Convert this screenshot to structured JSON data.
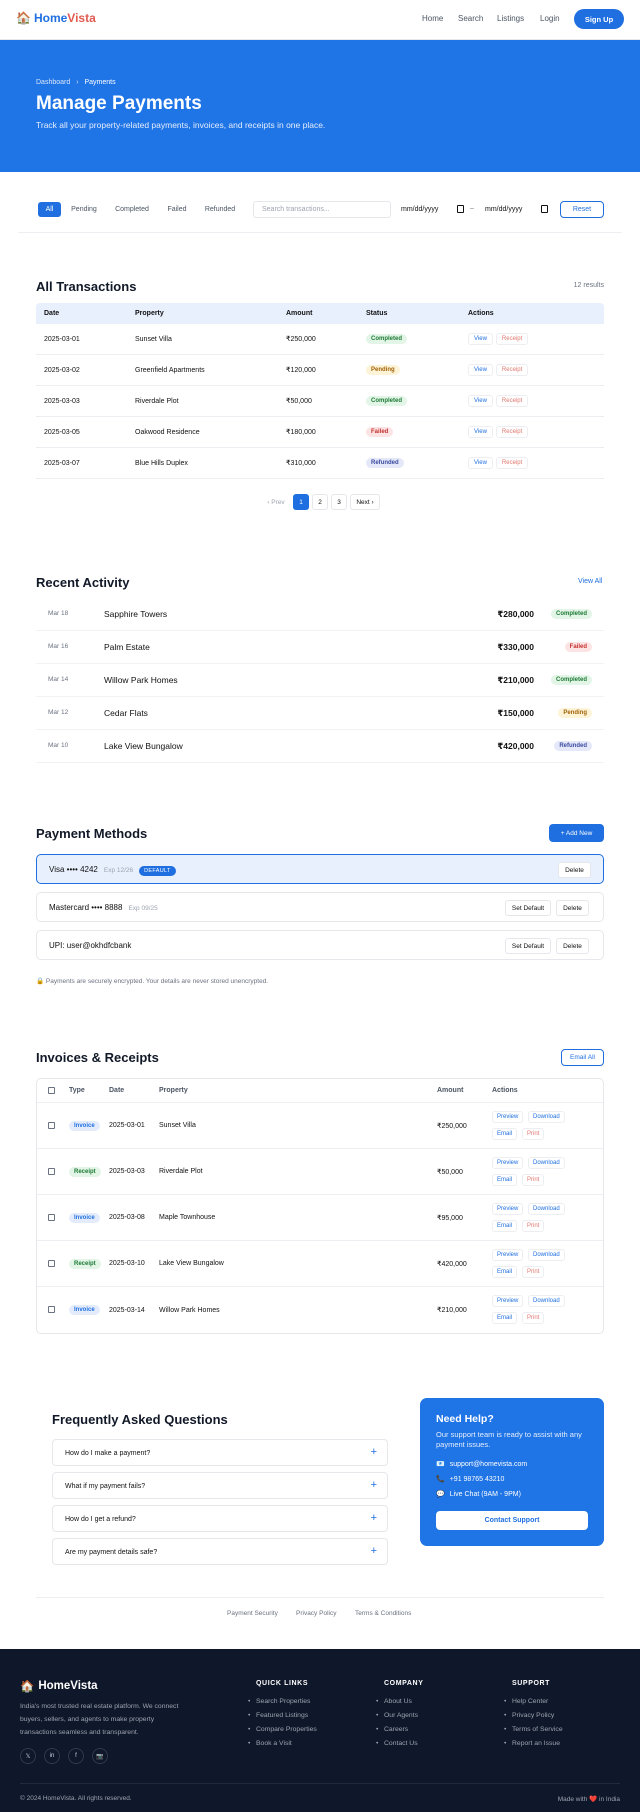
{
  "nav": {
    "brand_home": "Home",
    "brand_vista": "Vista",
    "links": [
      "Home",
      "Search",
      "Listings",
      "Login"
    ],
    "signup": "Sign Up"
  },
  "hero": {
    "crumb_root": "Dashboard",
    "crumb_sep": "›",
    "crumb_current": "Payments",
    "title": "Manage Payments",
    "subtitle": "Track all your property-related payments, invoices, and receipts in one place."
  },
  "filters": {
    "tabs": [
      "All",
      "Pending",
      "Completed",
      "Failed",
      "Refunded"
    ],
    "search_placeholder": "Search transactions...",
    "date_from": "mm/dd/yyyy",
    "date_sep": "–",
    "date_to": "mm/dd/yyyy",
    "reset": "Reset"
  },
  "transactions": {
    "title": "All Transactions",
    "count": "12 results",
    "headers": [
      "Date",
      "Property",
      "Amount",
      "Status",
      "Actions"
    ],
    "rows": [
      {
        "date": "2025-03-01",
        "property": "Sunset Villa",
        "amount": "₹250,000",
        "status": "Completed",
        "view": "View",
        "receipt": "Receipt"
      },
      {
        "date": "2025-03-02",
        "property": "Greenfield Apartments",
        "amount": "₹120,000",
        "status": "Pending",
        "view": "View",
        "receipt": "Receipt"
      },
      {
        "date": "2025-03-03",
        "property": "Riverdale Plot",
        "amount": "₹50,000",
        "status": "Completed",
        "view": "View",
        "receipt": "Receipt"
      },
      {
        "date": "2025-03-05",
        "property": "Oakwood Residence",
        "amount": "₹180,000",
        "status": "Failed",
        "view": "View",
        "receipt": "Receipt"
      },
      {
        "date": "2025-03-07",
        "property": "Blue Hills Duplex",
        "amount": "₹310,000",
        "status": "Refunded",
        "view": "View",
        "receipt": "Receipt"
      }
    ],
    "pager": {
      "prev": "‹ Prev",
      "pages": [
        "1",
        "2",
        "3"
      ],
      "next": "Next ›"
    }
  },
  "activity": {
    "title": "Recent Activity",
    "view_all": "View All",
    "items": [
      {
        "date": "Mar 18",
        "name": "Sapphire Towers",
        "amount": "₹280,000",
        "status": "Completed"
      },
      {
        "date": "Mar 16",
        "name": "Palm Estate",
        "amount": "₹330,000",
        "status": "Failed"
      },
      {
        "date": "Mar 14",
        "name": "Willow Park Homes",
        "amount": "₹210,000",
        "status": "Completed"
      },
      {
        "date": "Mar 12",
        "name": "Cedar Flats",
        "amount": "₹150,000",
        "status": "Pending"
      },
      {
        "date": "Mar 10",
        "name": "Lake View Bungalow",
        "amount": "₹420,000",
        "status": "Refunded"
      }
    ]
  },
  "methods": {
    "title": "Payment Methods",
    "add_new": "+ Add New",
    "cards": [
      {
        "label": "Visa •••• 4242",
        "exp": "Exp 12/26",
        "tag": "DEFAULT",
        "delete": "Delete"
      },
      {
        "label": "Mastercard •••• 8888",
        "exp": "Exp 09/25",
        "set_default": "Set Default",
        "delete": "Delete"
      },
      {
        "label": "UPI: user@okhdfcbank",
        "set_default": "Set Default",
        "delete": "Delete"
      }
    ],
    "secure_note": "Payments are securely encrypted. Your details are never stored unencrypted."
  },
  "invoices": {
    "title": "Invoices & Receipts",
    "email_all": "Email All",
    "headers": [
      "Type",
      "Date",
      "Property",
      "Amount",
      "Actions"
    ],
    "actions": {
      "preview": "Preview",
      "download": "Download",
      "email": "Email",
      "print": "Print"
    },
    "rows": [
      {
        "type": "Invoice",
        "date": "2025-03-01",
        "property": "Sunset Villa",
        "amount": "₹250,000"
      },
      {
        "type": "Receipt",
        "date": "2025-03-03",
        "property": "Riverdale Plot",
        "amount": "₹50,000"
      },
      {
        "type": "Invoice",
        "date": "2025-03-08",
        "property": "Maple Townhouse",
        "amount": "₹95,000"
      },
      {
        "type": "Receipt",
        "date": "2025-03-10",
        "property": "Lake View Bungalow",
        "amount": "₹420,000"
      },
      {
        "type": "Invoice",
        "date": "2025-03-14",
        "property": "Willow Park Homes",
        "amount": "₹210,000"
      }
    ]
  },
  "faq": {
    "title": "Frequently Asked Questions",
    "items": [
      "How do I make a payment?",
      "What if my payment fails?",
      "How do I get a refund?",
      "Are my payment details safe?"
    ],
    "expand": "+"
  },
  "help": {
    "title": "Need Help?",
    "subtitle": "Our support team is ready to assist with any payment issues.",
    "email": "support@homevista.com",
    "phone": "+91 98765 43210",
    "chat": "Live Chat (9AM - 9PM)",
    "contact": "Contact Support"
  },
  "policy_links": [
    "Payment Security",
    "Privacy Policy",
    "Terms & Conditions"
  ],
  "footer": {
    "brand": "HomeVista",
    "description": "India's most trusted real estate platform. We connect buyers, sellers, and agents to make property transactions seamless and transparent.",
    "social": [
      "𝕏",
      "in",
      "f",
      "📷"
    ],
    "quick_links": {
      "title": "QUICK LINKS",
      "items": [
        "Search Properties",
        "Featured Listings",
        "Compare Properties",
        "Book a Visit"
      ]
    },
    "company": {
      "title": "COMPANY",
      "items": [
        "About Us",
        "Our Agents",
        "Careers",
        "Contact Us"
      ]
    },
    "support": {
      "title": "SUPPORT",
      "items": [
        "Help Center",
        "Privacy Policy",
        "Terms of Service",
        "Report an Issue"
      ]
    },
    "copyright": "© 2024 HomeVista. All rights reserved.",
    "made_prefix": "Made with",
    "made_suffix": "in India"
  },
  "colors": {
    "primary": "#1f6fe0",
    "hero": "#1f74e6",
    "footer": "#0f172a"
  }
}
